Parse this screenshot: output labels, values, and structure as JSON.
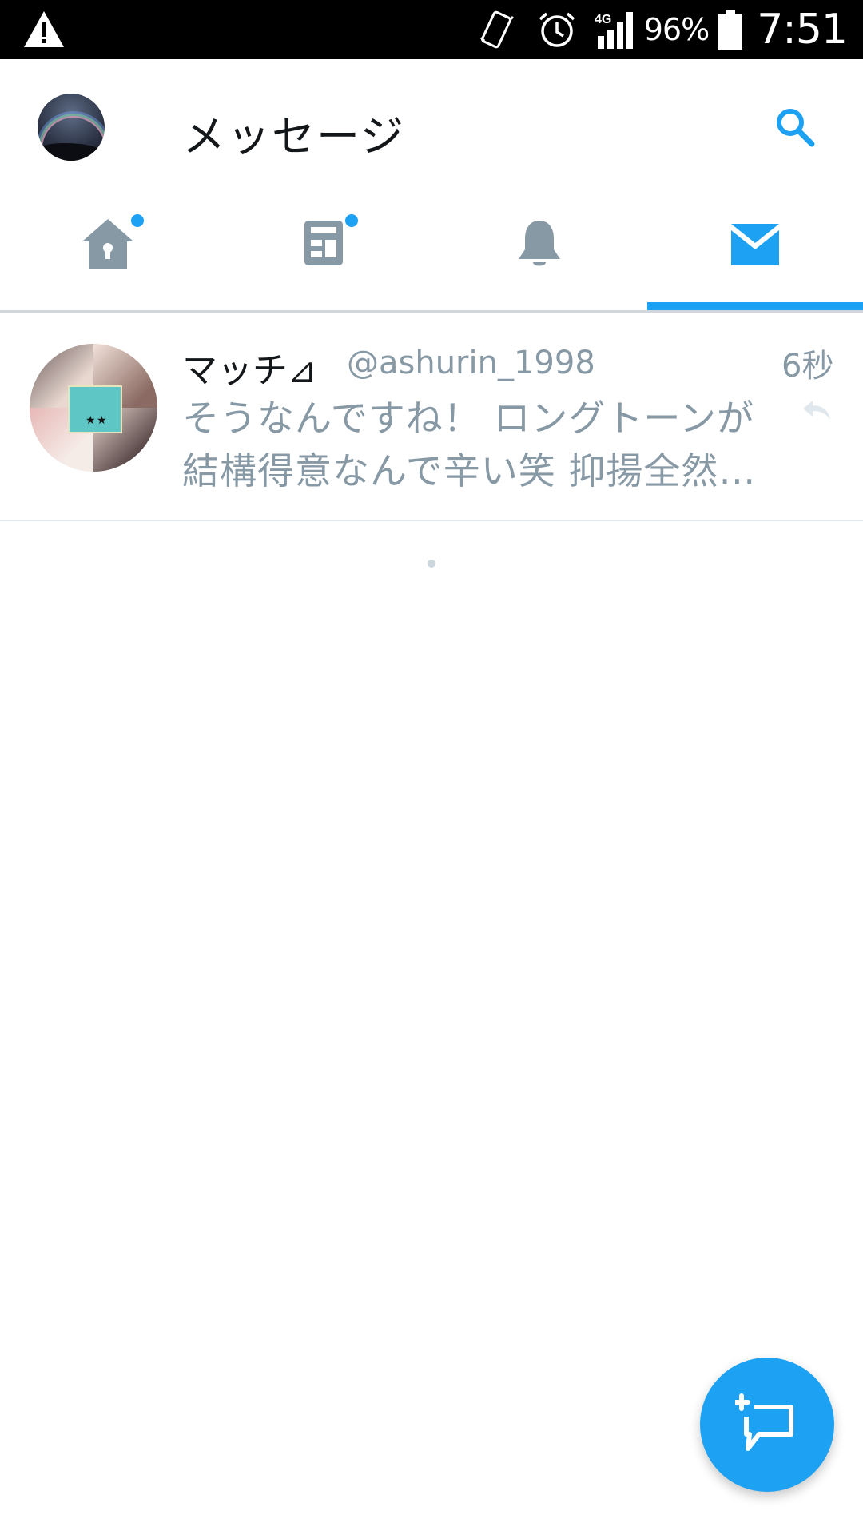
{
  "status_bar": {
    "battery_percent": "96%",
    "time": "7:51",
    "network": "4G",
    "icons": [
      "warning-icon",
      "vibrate-icon",
      "alarm-icon",
      "signal-icon",
      "battery-icon"
    ]
  },
  "header": {
    "title": "メッセージ",
    "search_icon": "search-icon",
    "avatar": "profile-avatar"
  },
  "tabs": [
    {
      "name": "home",
      "icon": "home-icon",
      "has_badge": true,
      "active": false
    },
    {
      "name": "moments",
      "icon": "moments-icon",
      "has_badge": true,
      "active": false
    },
    {
      "name": "notifications",
      "icon": "bell-icon",
      "has_badge": false,
      "active": false
    },
    {
      "name": "messages",
      "icon": "mail-icon",
      "has_badge": false,
      "active": true
    }
  ],
  "messages": [
    {
      "name": "マッチ⊿",
      "handle": "@ashurin_1998",
      "time": "6秒",
      "preview_line1": "そうなんですね！ ロングトーンが",
      "preview_line2": "結構得意なんで辛い笑 抑揚全然…"
    }
  ],
  "fab": {
    "icon": "new-message-icon"
  },
  "colors": {
    "accent": "#1da1f2",
    "icon_gray": "#8899a6",
    "text_primary": "#14171a"
  }
}
